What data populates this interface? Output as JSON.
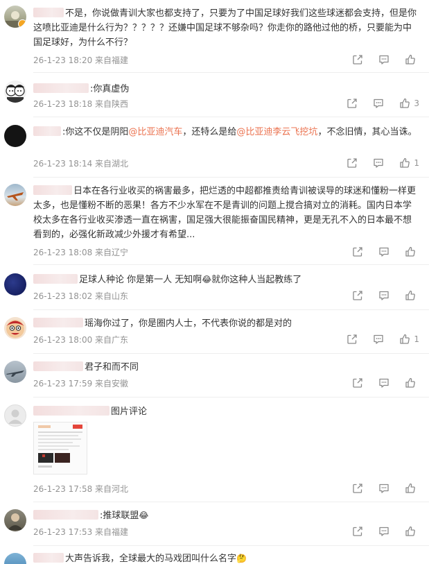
{
  "comments": [
    {
      "text": "不是，你说做青训大家也都支持了，只要为了中国足球好我们这些球迷都会支持，但是你这喷比亚迪是什么行为？？？？？还嫌中国足球不够杂吗？你走你的路他过他的桥，只要能为中国足球好，为什么不行？",
      "meta": "26-1-23 18:20 来自福建",
      "likes": ""
    },
    {
      "text": ":你真虚伪",
      "meta": "26-1-23 18:18 来自陕西",
      "likes": "3"
    },
    {
      "text_a": ":你这不仅是阴阳",
      "mention_a": "@比亚迪汽车",
      "text_b": "，还特么是给",
      "mention_b": "@比亚迪李云飞挖坑",
      "text_c": "，不念旧情，其心当诛。",
      "meta": "26-1-23 18:14 来自湖北",
      "likes": "1"
    },
    {
      "text": "日本在各行业收买的祸害最多，把烂透的中超都推责给青训被误导的球迷和懂粉一样更太多，也是懂粉不断的恶果！各方不少水军在不是青训的问题上搅合搞对立的消耗。国内日本学校太多在各行业收买渗透一直在祸害，国足强大很能振奋国民精神，更是无孔不入的日本最不想看到的，必强化新政减少外援才有希望...",
      "meta": "26-1-23 18:08 来自辽宁",
      "likes": ""
    },
    {
      "text_a": "足球人种论 你是第一人 无知啊",
      "emoji": "😂",
      "text_b": "就你这种人当起教练了",
      "meta": "26-1-23 18:02 来自山东",
      "likes": ""
    },
    {
      "text": "瑶海你过了，你是圈内人士，不代表你说的都是对的",
      "meta": "26-1-23 18:00 来自广东",
      "likes": "1"
    },
    {
      "text": "君子和而不同",
      "meta": "26-1-23 17:59 来自安徽",
      "likes": ""
    },
    {
      "text": "图片评论",
      "meta": "26-1-23 17:58 来自河北",
      "likes": ""
    },
    {
      "text": ":推球联盟",
      "emoji": "😂",
      "meta": "26-1-23 17:53 来自福建",
      "likes": ""
    },
    {
      "text": "大声告诉我，全球最大的马戏团叫什么名字",
      "emoji": "🤔"
    }
  ],
  "icons": {
    "share": "share-icon",
    "comment": "comment-icon",
    "like": "like-icon"
  },
  "colors": {
    "mention": "#eb7350",
    "meta": "#939393",
    "text": "#333333"
  }
}
